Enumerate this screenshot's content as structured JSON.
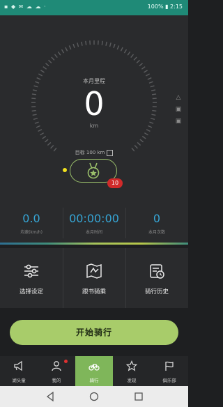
{
  "status_bar": {
    "left_icons": "▪ ◆ ✉ ☁ ☁ ·",
    "right_text": "100% ▮ 2:15"
  },
  "dashboard": {
    "month_label": "本月里程",
    "distance_value": "0",
    "distance_unit": "km",
    "goal_label": "目标 100 km",
    "medal_badge_count": "10"
  },
  "stats": [
    {
      "value": "0.0",
      "label": "均速(km/h)"
    },
    {
      "value": "00:00:00",
      "label": "本月时间"
    },
    {
      "value": "0",
      "label": "本月次数"
    }
  ],
  "menu": [
    {
      "label": "选择设定",
      "icon": "sliders-icon"
    },
    {
      "label": "跟书骑乘",
      "icon": "map-icon"
    },
    {
      "label": "骑行历史",
      "icon": "history-icon"
    }
  ],
  "start_button": {
    "label": "开始骑行"
  },
  "tabs": [
    {
      "label": "湖头童",
      "icon": "megaphone-icon",
      "active": false
    },
    {
      "label": "我的",
      "icon": "person-icon",
      "active": false
    },
    {
      "label": "骑行",
      "icon": "bicycle-icon",
      "active": true
    },
    {
      "label": "发现",
      "icon": "star-icon",
      "active": false
    },
    {
      "label": "俱乐部",
      "icon": "flag-icon",
      "active": false
    }
  ],
  "colors": {
    "status_bar": "#1f8a77",
    "accent_green": "#a8cc6a",
    "stat_blue": "#36a6d6",
    "badge_red": "#d12a2a"
  }
}
